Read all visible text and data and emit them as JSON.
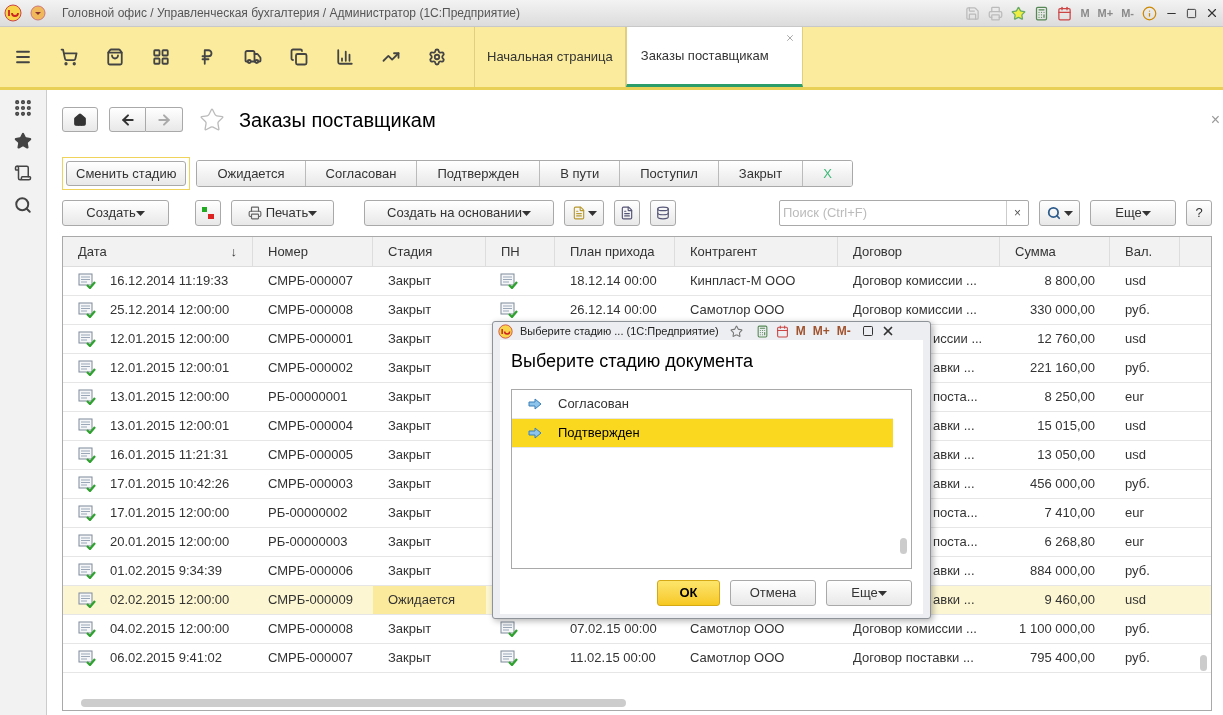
{
  "window": {
    "title": "Головной офис / Управленческая бухгалтерия / Администратор  (1С:Предприятие)",
    "memory_keys": [
      "M",
      "M+",
      "M-"
    ]
  },
  "tabs": [
    {
      "label": "Начальная страница",
      "selected": false,
      "closable": false
    },
    {
      "label": "Заказы поставщикам",
      "selected": true,
      "closable": true
    }
  ],
  "page": {
    "title": "Заказы поставщикам",
    "close": "×"
  },
  "stage_bar": {
    "change_stage": "Сменить стадию",
    "stages": [
      {
        "label": "Ожидается",
        "kind": "stage"
      },
      {
        "label": "Согласован",
        "kind": "stage"
      },
      {
        "label": "Подтвержден",
        "kind": "stage"
      },
      {
        "label": "В пути",
        "kind": "stage"
      },
      {
        "label": "Поступил",
        "kind": "stage"
      },
      {
        "label": "Закрыт",
        "kind": "stage"
      },
      {
        "label": "X",
        "kind": "clear"
      }
    ]
  },
  "toolbar": {
    "create": "Создать",
    "print": "Печать",
    "create_based": "Создать на основании",
    "search_placeholder": "Поиск (Ctrl+F)",
    "search_clear": "×",
    "more": "Еще",
    "help": "?"
  },
  "table": {
    "columns": [
      {
        "label": "Дата",
        "sort": "↓"
      },
      {
        "label": "Номер"
      },
      {
        "label": "Стадия"
      },
      {
        "label": "ПН"
      },
      {
        "label": "План прихода"
      },
      {
        "label": "Контрагент"
      },
      {
        "label": "Договор"
      },
      {
        "label": "Сумма"
      },
      {
        "label": "Вал."
      }
    ],
    "rows": [
      {
        "date": "16.12.2014 11:19:33",
        "number": "СМРБ-000007",
        "stage": "Закрыт",
        "pn": true,
        "plan": "18.12.14 00:00",
        "counterparty": "Кинпласт-М ООО",
        "contract": "Договор комиссии ...",
        "covered": false,
        "sum": "8 800,00",
        "currency": "usd",
        "selected": false
      },
      {
        "date": "25.12.2014 12:00:00",
        "number": "СМРБ-000008",
        "stage": "Закрыт",
        "pn": true,
        "plan": "26.12.14 00:00",
        "counterparty": "Самотлор ООО",
        "contract": "Договор комиссии ...",
        "covered": false,
        "sum": "330 000,00",
        "currency": "руб.",
        "selected": false
      },
      {
        "date": "12.01.2015 12:00:00",
        "number": "СМРБ-000001",
        "stage": "Закрыт",
        "contract": "иссии ...",
        "covered": true,
        "sum": "12 760,00",
        "currency": "usd",
        "selected": false
      },
      {
        "date": "12.01.2015 12:00:01",
        "number": "СМРБ-000002",
        "stage": "Закрыт",
        "contract": "авки ...",
        "covered": true,
        "sum": "221 160,00",
        "currency": "руб.",
        "selected": false
      },
      {
        "date": "13.01.2015 12:00:00",
        "number": "РБ-00000001",
        "stage": "Закрыт",
        "contract": "поста...",
        "covered": true,
        "sum": "8 250,00",
        "currency": "eur",
        "selected": false
      },
      {
        "date": "13.01.2015 12:00:01",
        "number": "СМРБ-000004",
        "stage": "Закрыт",
        "contract": "авки ...",
        "covered": true,
        "sum": "15 015,00",
        "currency": "usd",
        "selected": false
      },
      {
        "date": "16.01.2015 11:21:31",
        "number": "СМРБ-000005",
        "stage": "Закрыт",
        "contract": "авки ...",
        "covered": true,
        "sum": "13 050,00",
        "currency": "usd",
        "selected": false
      },
      {
        "date": "17.01.2015 10:42:26",
        "number": "СМРБ-000003",
        "stage": "Закрыт",
        "contract": "авки ...",
        "covered": true,
        "sum": "456 000,00",
        "currency": "руб.",
        "selected": false
      },
      {
        "date": "17.01.2015 12:00:00",
        "number": "РБ-00000002",
        "stage": "Закрыт",
        "contract": "поста...",
        "covered": true,
        "sum": "7 410,00",
        "currency": "eur",
        "selected": false
      },
      {
        "date": "20.01.2015 12:00:00",
        "number": "РБ-00000003",
        "stage": "Закрыт",
        "contract": "поста...",
        "covered": true,
        "sum": "6 268,80",
        "currency": "eur",
        "selected": false
      },
      {
        "date": "01.02.2015 9:34:39",
        "number": "СМРБ-000006",
        "stage": "Закрыт",
        "contract": "авки ...",
        "covered": true,
        "sum": "884 000,00",
        "currency": "руб.",
        "selected": false
      },
      {
        "date": "02.02.2015 12:00:00",
        "number": "СМРБ-000009",
        "stage": "Ожидается",
        "contract": "авки ...",
        "covered": true,
        "sum": "9 460,00",
        "currency": "usd",
        "selected": true
      },
      {
        "date": "04.02.2015 12:00:00",
        "number": "СМРБ-000008",
        "stage": "Закрыт",
        "pn": true,
        "plan": "07.02.15 00:00",
        "counterparty": "Самотлор ООО",
        "contract": "Договор комиссии ...",
        "covered": false,
        "sum": "1 100 000,00",
        "currency": "руб.",
        "selected": false
      },
      {
        "date": "06.02.2015 9:41:02",
        "number": "СМРБ-000007",
        "stage": "Закрыт",
        "pn": true,
        "plan": "11.02.15 00:00",
        "counterparty": "Самотлор ООО",
        "contract": "Договор поставки ...",
        "covered": false,
        "sum": "795 400,00",
        "currency": "руб.",
        "selected": false
      }
    ]
  },
  "dialog": {
    "title": "Выберите стадию ...  (1С:Предприятие)",
    "memory_keys": [
      "M",
      "M+",
      "M-"
    ],
    "heading": "Выберите стадию документа",
    "options": [
      {
        "label": "Согласован",
        "selected": false
      },
      {
        "label": "Подтвержден",
        "selected": true
      }
    ],
    "ok": "ОК",
    "cancel": "Отмена",
    "more": "Еще"
  }
}
